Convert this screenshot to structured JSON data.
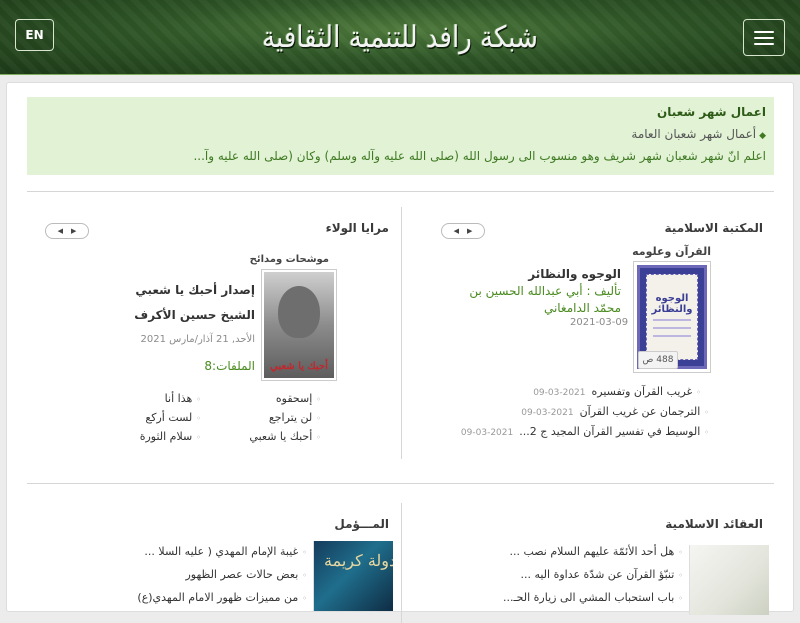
{
  "header": {
    "lang_label": "EN",
    "logo_text": "شبكة رافد للتنمية الثقافية"
  },
  "notice": {
    "title": "اعمال شهر شعبان",
    "subtitle": "أعمال شهر شعبان العامة",
    "text": "اعلم انّ شهر شعبان شهر شريف وهو منسوب الى رسول الله (صلى الله عليه وآله وسلم) وكان (صلى الله عليه وآ..."
  },
  "library": {
    "title": "المكتبة الاسلامية",
    "category": "القرآن وعلومه",
    "book": {
      "title": "الوجوه والنظائر",
      "author_line1": "تأليف : أبي عبدالله الحسين بن",
      "author_line2": "محمّد الدامغاني",
      "date": "2021-03-09",
      "pages": "488 ص",
      "cover_text": "الوجوه والنظائر"
    },
    "items": [
      {
        "title": "غريب القرآن وتفسيره",
        "date": "2021-03-09"
      },
      {
        "title": "الترجمان عن غريب القرآن",
        "date": "2021-03-09"
      },
      {
        "title": "الوسيط في تفسير القرآن المجيد ج 2...",
        "date": "2021-03-09"
      }
    ]
  },
  "mirrors": {
    "title": "مرايا الولاء",
    "category": "موشحات ومدائح",
    "release_title": "إصدار أحبك يا شعبي",
    "artist": "الشيخ حسين الأكرف",
    "date": "الأحد, 21 آذار/مارس 2021",
    "files": "الملفات:8",
    "thumb_caption": "أحبك يا شعبي",
    "list_right": [
      "إسحقوه",
      "لن يتراجع",
      "أحبك يا شعبي"
    ],
    "list_left": [
      "هذا أنا",
      "لست أركع",
      "سلام الثورة"
    ]
  },
  "aqaid": {
    "title": "العقائد الاسلامية",
    "items": [
      "هل أحد الأئمّة عليهم السلام نصب ...",
      "تنبّؤ القرآن عن شدّة عداوة اليه ...",
      "باب استحباب المشي الى زيارة الحـ..."
    ]
  },
  "mumal": {
    "title": "المـــؤمل",
    "thumb_text": "دولة كريمة",
    "items": [
      "غيبة الإمام المهدي ( عليه السلا ...",
      "بعض حالات عصر الظهور",
      "من مميزات ظهور الامام المهدي(ع)"
    ]
  }
}
